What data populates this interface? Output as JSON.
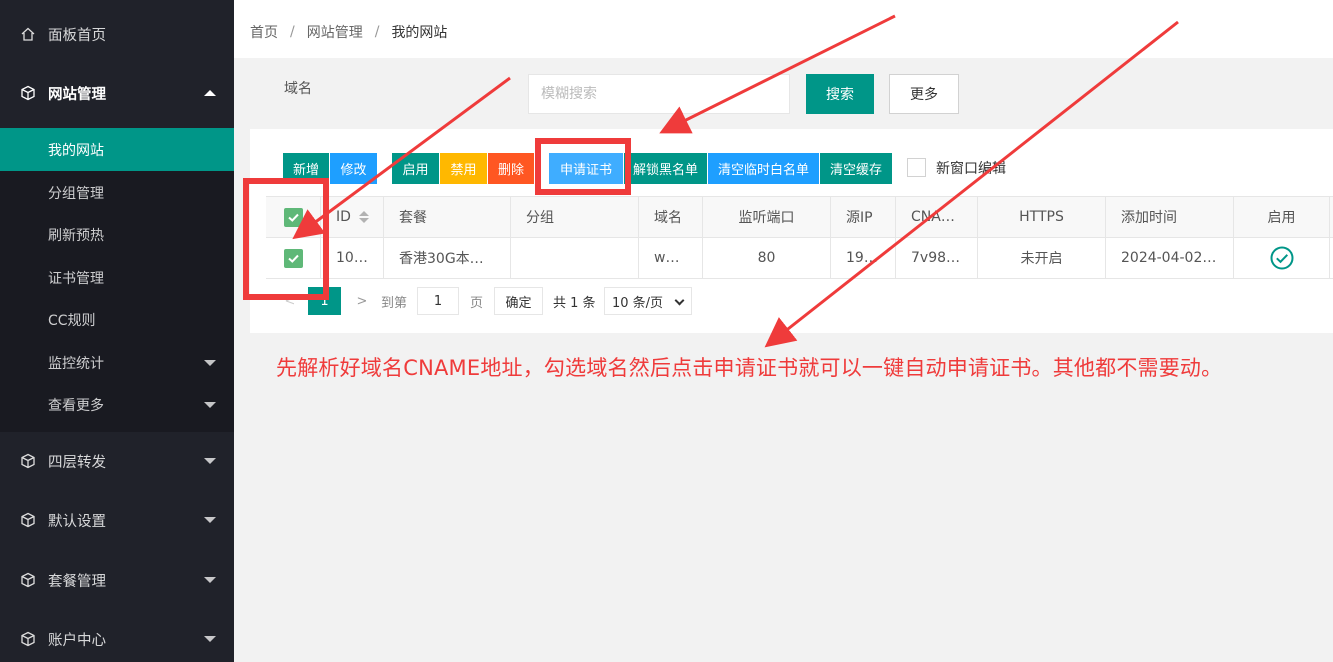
{
  "sidebar": {
    "items": [
      {
        "label": "面板首页"
      },
      {
        "label": "网站管理"
      },
      {
        "label": "四层转发"
      },
      {
        "label": "默认设置"
      },
      {
        "label": "套餐管理"
      },
      {
        "label": "账户中心"
      }
    ],
    "submenu": [
      {
        "label": "我的网站"
      },
      {
        "label": "分组管理"
      },
      {
        "label": "刷新预热"
      },
      {
        "label": "证书管理"
      },
      {
        "label": "CC规则"
      },
      {
        "label": "监控统计"
      },
      {
        "label": "查看更多"
      }
    ]
  },
  "breadcrumb": [
    "首页",
    "网站管理",
    "我的网站"
  ],
  "search": {
    "label": "域名",
    "placeholder": "模糊搜索",
    "search_button": "搜索",
    "more_button": "更多"
  },
  "toolbar": {
    "add": "新增",
    "edit": "修改",
    "enable": "启用",
    "disable": "禁用",
    "delete": "删除",
    "apply_cert": "申请证书",
    "unlock_blacklist": "解锁黑名单",
    "clear_temp_whitelist": "清空临时白名单",
    "clear_cache": "清空缓存",
    "new_window_edit": "新窗口编辑"
  },
  "table": {
    "columns": [
      "ID",
      "套餐",
      "分组",
      "域名",
      "监听端口",
      "源IP",
      "CNA…",
      "HTTPS",
      "添加时间",
      "启用"
    ],
    "rows": [
      {
        "checked": true,
        "id": "10…",
        "plan": "香港30G本…",
        "group": "",
        "domain": "w…",
        "port": "80",
        "source_ip": "19…",
        "cname": "7v98…",
        "https": "未开启",
        "added": "2024-04-02…",
        "enabled": true
      }
    ]
  },
  "pager": {
    "current": "1",
    "goto_label": "到第",
    "goto_value": "1",
    "page_label": "页",
    "confirm": "确定",
    "total": "共 1 条",
    "page_size": "10 条/页"
  },
  "annotation": {
    "text": "先解析好域名CNAME地址，勾选域名然后点击申请证书就可以一键自动申请证书。其他都不需要动。"
  },
  "colors": {
    "sidebar_bg": "#20222a",
    "accent": "#009688",
    "blue": "#1e9fff",
    "orange": "#ffb800",
    "red": "#ff5722",
    "annotation": "#ef3b3b"
  }
}
